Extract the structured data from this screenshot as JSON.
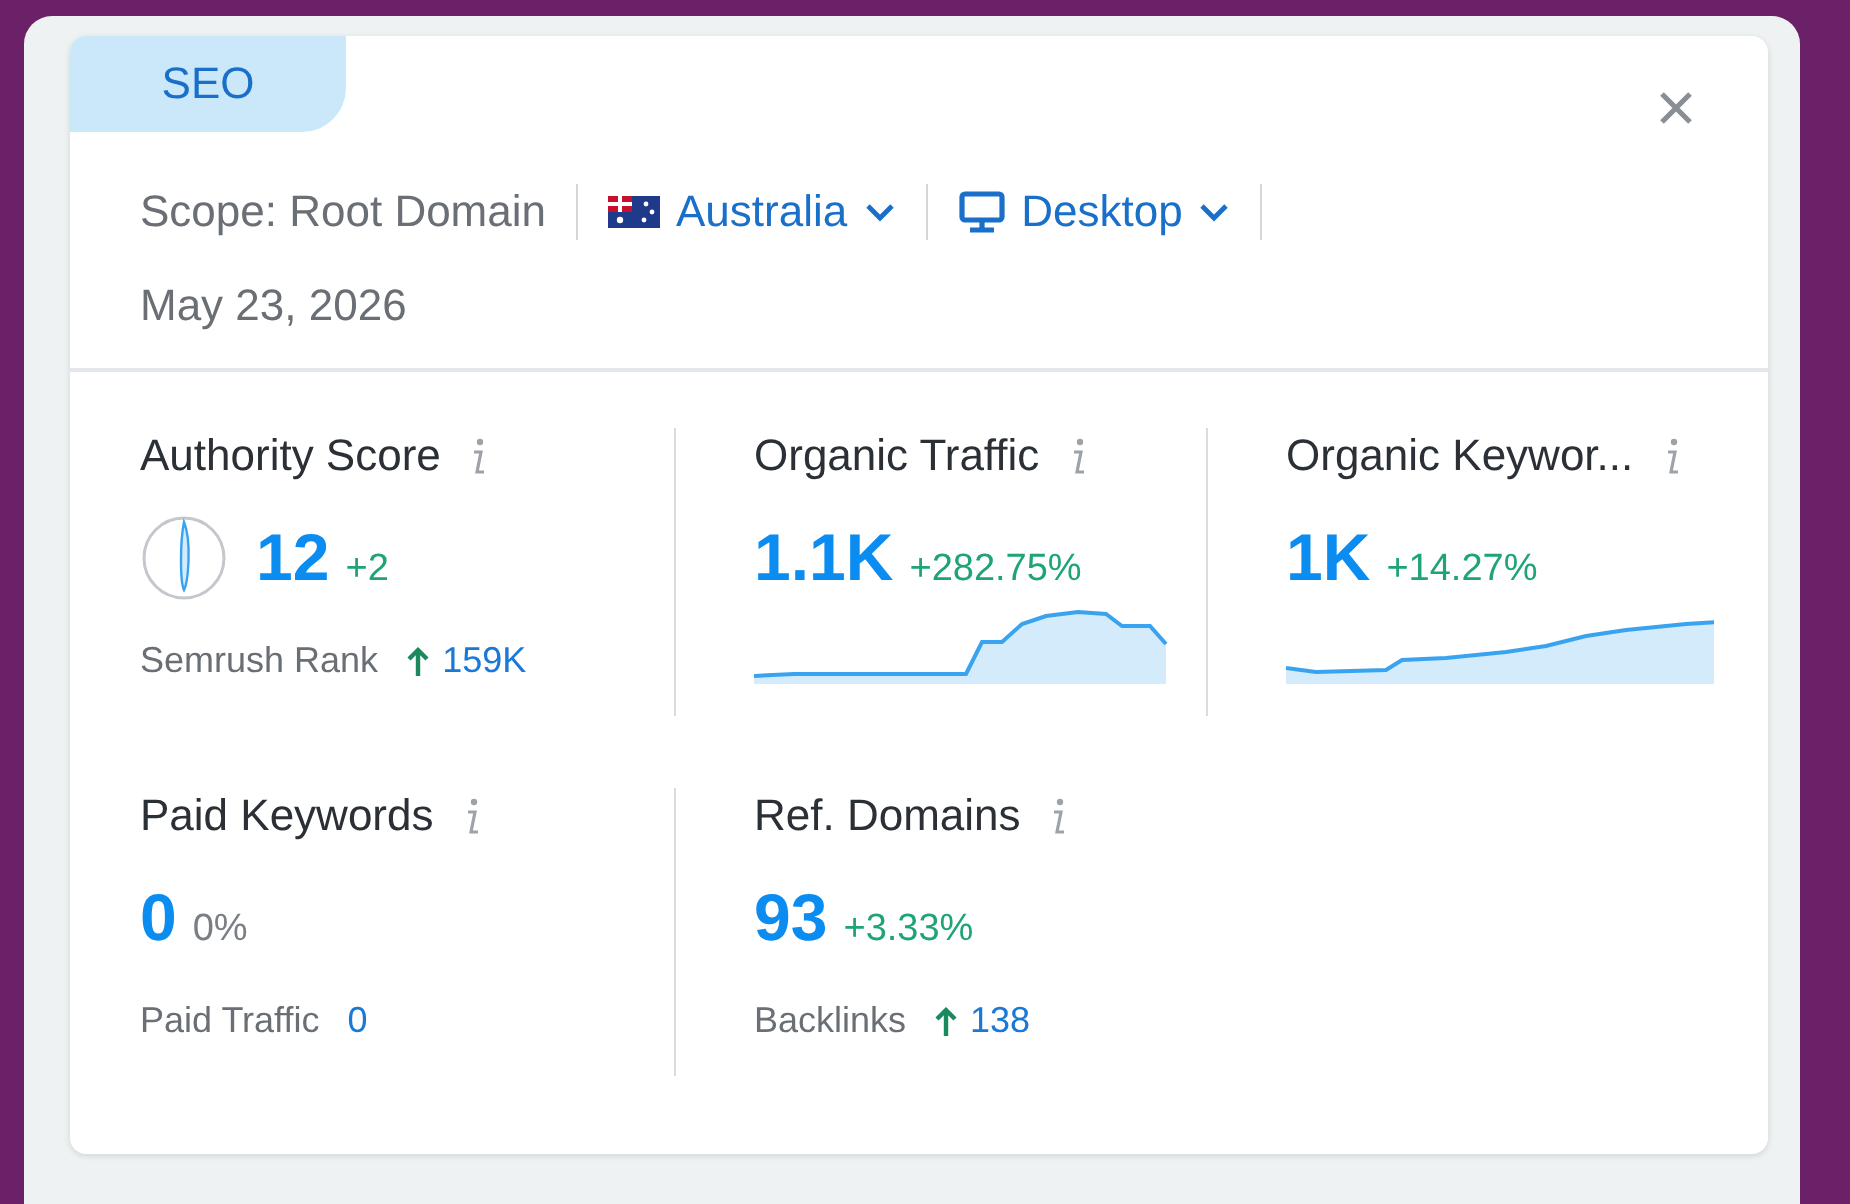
{
  "tag": "SEO",
  "scope": {
    "label": "Scope: Root Domain",
    "country": "Australia",
    "device": "Desktop"
  },
  "date": "May 23, 2026",
  "metrics": [
    {
      "title": "Authority Score",
      "value": "12",
      "change": "+2",
      "positive": true,
      "gauge": true,
      "kind": "footer",
      "footer": {
        "label": "Semrush Rank",
        "value": "159K",
        "rising": true
      }
    },
    {
      "title": "Organic Traffic",
      "value": "1.1K",
      "change": "+282.75%",
      "positive": true,
      "gauge": false,
      "kind": "sparkline"
    },
    {
      "title": "Organic Keywor...",
      "value": "1K",
      "change": "+14.27%",
      "positive": true,
      "gauge": false,
      "kind": "sparkline"
    },
    {
      "title": "Paid Keywords",
      "value": "0",
      "change": "0%",
      "positive": false,
      "gauge": false,
      "kind": "footer",
      "footer": {
        "label": "Paid Traffic",
        "value": "0",
        "rising": false
      }
    },
    {
      "title": "Ref. Domains",
      "value": "93",
      "change": "+3.33%",
      "positive": true,
      "gauge": false,
      "kind": "footer",
      "footer": {
        "label": "Backlinks",
        "value": "138",
        "rising": true
      }
    }
  ]
}
